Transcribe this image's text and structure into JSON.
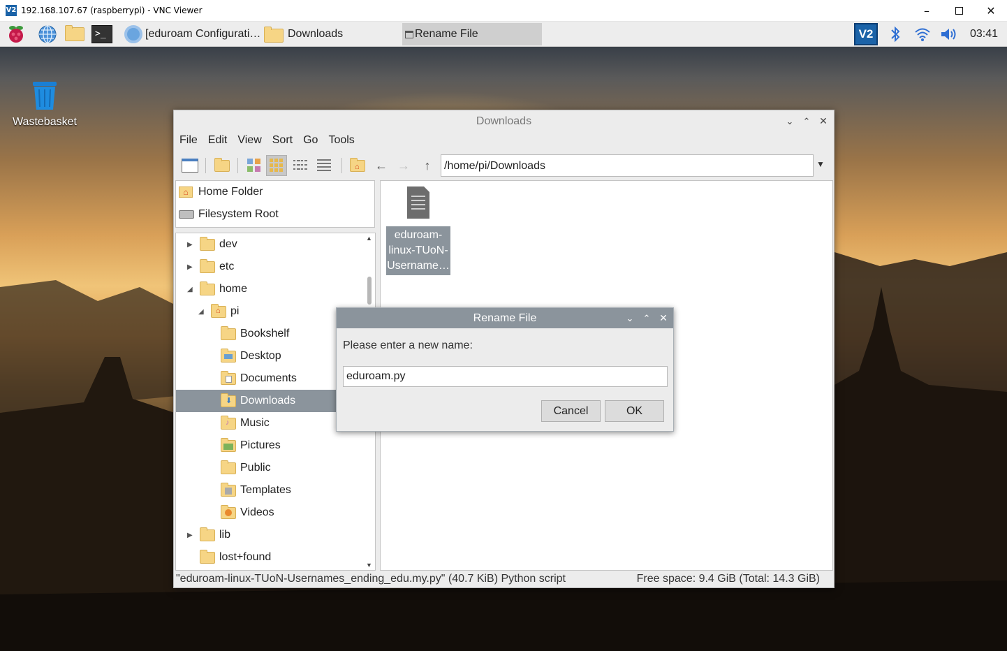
{
  "vnc": {
    "title": "192.168.107.67 (raspberrypi) - VNC Viewer",
    "logo": "V2"
  },
  "taskbar": {
    "tasks": [
      {
        "label": "[eduroam Configurati…"
      },
      {
        "label": "Downloads"
      },
      {
        "label": "Rename File"
      }
    ],
    "clock": "03:41",
    "vnc_tray": "V2"
  },
  "desktop": {
    "wastebasket_label": "Wastebasket"
  },
  "filemanager": {
    "title": "Downloads",
    "menu": [
      "File",
      "Edit",
      "View",
      "Sort",
      "Go",
      "Tools"
    ],
    "address": "/home/pi/Downloads",
    "places": [
      {
        "label": "Home Folder",
        "icon": "home-icon"
      },
      {
        "label": "Filesystem Root",
        "icon": "drive-icon"
      }
    ],
    "tree": [
      {
        "label": "dev",
        "expander": "▶"
      },
      {
        "label": "etc",
        "expander": "▶"
      },
      {
        "label": "home",
        "expander": "◢"
      },
      {
        "label": "pi",
        "expander": "◢"
      },
      {
        "label": "Bookshelf",
        "expander": ""
      },
      {
        "label": "Desktop",
        "expander": ""
      },
      {
        "label": "Documents",
        "expander": ""
      },
      {
        "label": "Downloads",
        "expander": ""
      },
      {
        "label": "Music",
        "expander": ""
      },
      {
        "label": "Pictures",
        "expander": ""
      },
      {
        "label": "Public",
        "expander": ""
      },
      {
        "label": "Templates",
        "expander": ""
      },
      {
        "label": "Videos",
        "expander": ""
      },
      {
        "label": "lib",
        "expander": "▶"
      },
      {
        "label": "lost+found",
        "expander": ""
      }
    ],
    "file": {
      "line1": "eduroam-",
      "line2": "linux-TUoN-",
      "line3": "Username…"
    },
    "status_left": "\"eduroam-linux-TUoN-Usernames_ending_edu.my.py\" (40.7 KiB) Python script",
    "status_right": "Free space: 9.4 GiB (Total: 14.3 GiB)"
  },
  "dialog": {
    "title": "Rename File",
    "prompt": "Please enter a new name:",
    "value": "eduroam.py",
    "cancel": "Cancel",
    "ok": "OK"
  },
  "colors": {
    "selection": "#8b949c",
    "folder": "#f6d585",
    "vnc_blue": "#1b63a8"
  }
}
